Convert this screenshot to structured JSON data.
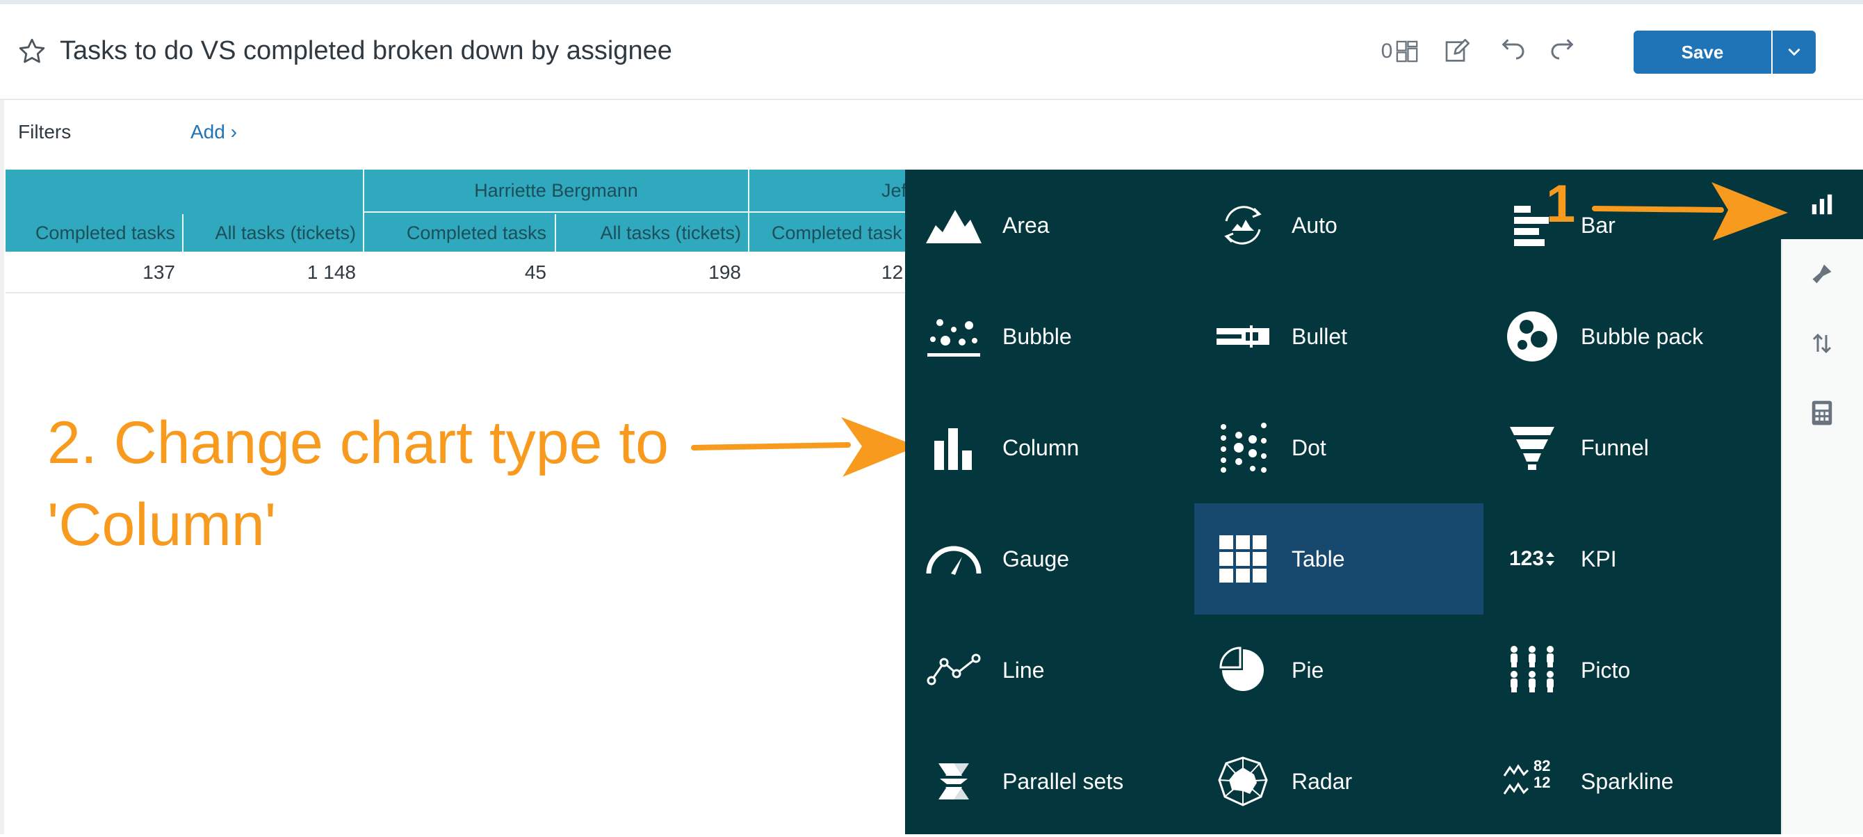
{
  "header": {
    "title": "Tasks to do VS completed broken down by assignee",
    "widget_count": "0",
    "save_label": "Save"
  },
  "filters": {
    "label": "Filters",
    "add_label": "Add ›"
  },
  "table": {
    "groups": [
      "Harriette Bergmann",
      "Jef"
    ],
    "columns": [
      "Completed tasks",
      "All tasks (tickets)",
      "Completed tasks",
      "All tasks (tickets)",
      "Completed task"
    ],
    "row": [
      "137",
      "1 148",
      "45",
      "198",
      "12"
    ]
  },
  "annotation": {
    "step1": "1",
    "step2": "2. Change chart type to 'Column'"
  },
  "chart_types": [
    {
      "label": "Area",
      "icon": "area-icon"
    },
    {
      "label": "Auto",
      "icon": "auto-icon"
    },
    {
      "label": "Bar",
      "icon": "bar-icon"
    },
    {
      "label": "Bubble",
      "icon": "bubble-icon"
    },
    {
      "label": "Bullet",
      "icon": "bullet-icon"
    },
    {
      "label": "Bubble pack",
      "icon": "bubble-pack-icon"
    },
    {
      "label": "Column",
      "icon": "column-icon"
    },
    {
      "label": "Dot",
      "icon": "dot-icon"
    },
    {
      "label": "Funnel",
      "icon": "funnel-icon"
    },
    {
      "label": "Gauge",
      "icon": "gauge-icon"
    },
    {
      "label": "Table",
      "icon": "table-icon",
      "selected": true
    },
    {
      "label": "KPI",
      "icon": "kpi-icon",
      "icon_text": "123"
    },
    {
      "label": "Line",
      "icon": "line-icon"
    },
    {
      "label": "Pie",
      "icon": "pie-icon"
    },
    {
      "label": "Picto",
      "icon": "picto-icon"
    },
    {
      "label": "Parallel sets",
      "icon": "parallel-sets-icon"
    },
    {
      "label": "Radar",
      "icon": "radar-icon"
    },
    {
      "label": "Sparkline",
      "icon": "sparkline-icon",
      "icon_text_top": "82",
      "icon_text_bottom": "12"
    }
  ],
  "colors": {
    "panel": "#03363d",
    "selected": "#17496e",
    "accent": "#f79a1e",
    "save": "#1f73b7",
    "table_header": "#30a8bd"
  }
}
